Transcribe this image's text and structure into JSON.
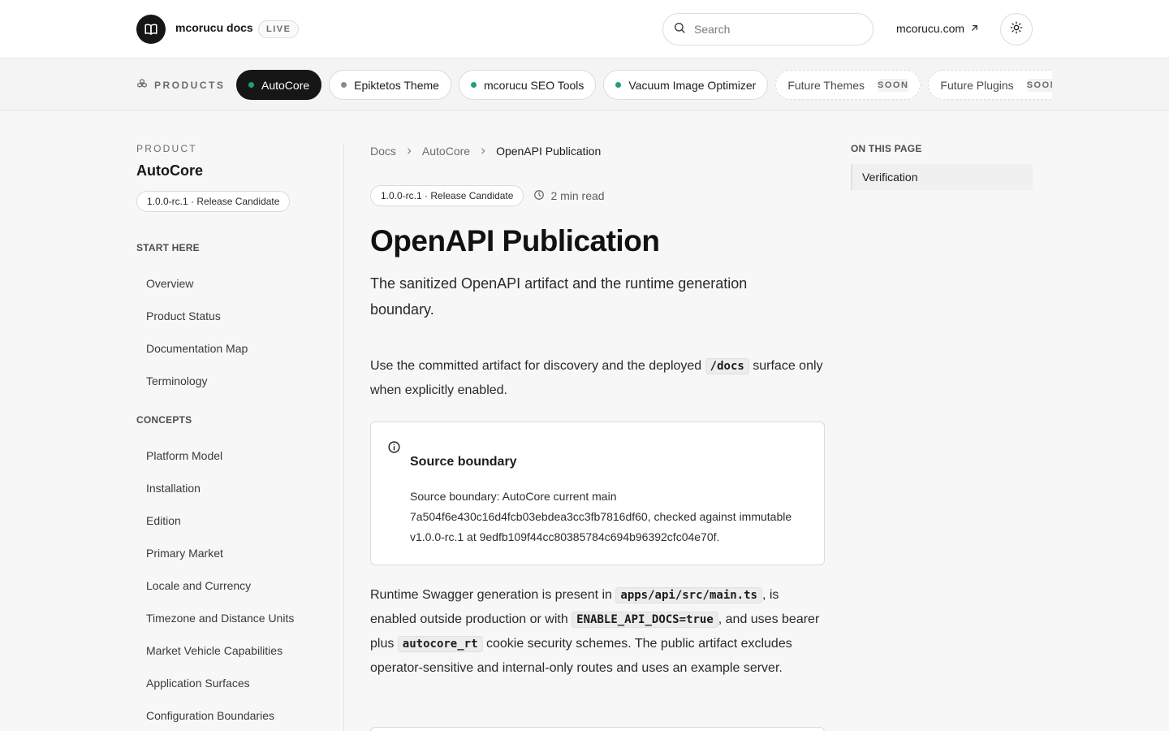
{
  "header": {
    "site_title": "mcorucu docs",
    "live_badge": "LIVE",
    "search_placeholder": "Search",
    "external_link": "mcorucu.com",
    "logo_icon": "book-icon",
    "theme_icon": "sun-icon"
  },
  "products": {
    "label": "PRODUCTS",
    "items": [
      {
        "label": "AutoCore",
        "dot_color": "#22a06b",
        "active": true
      },
      {
        "label": "Epiktetos Theme",
        "dot_color": "#8a8a8a",
        "active": false
      },
      {
        "label": "mcorucu SEO Tools",
        "dot_color": "#22a06b",
        "active": false
      },
      {
        "label": "Vacuum Image Optimizer",
        "dot_color": "#22a06b",
        "active": false
      }
    ],
    "future": [
      {
        "label": "Future Themes",
        "tag": "SOON"
      },
      {
        "label": "Future Plugins",
        "tag": "SOON"
      }
    ]
  },
  "sidebar": {
    "kicker": "PRODUCT",
    "product_name": "AutoCore",
    "version_badge": "1.0.0-rc.1 · Release Candidate",
    "sections": [
      {
        "title": "START HERE",
        "items": [
          "Overview",
          "Product Status",
          "Documentation Map",
          "Terminology"
        ]
      },
      {
        "title": "CONCEPTS",
        "items": [
          "Platform Model",
          "Installation",
          "Edition",
          "Primary Market",
          "Locale and Currency",
          "Timezone and Distance Units",
          "Market Vehicle Capabilities",
          "Application Surfaces",
          "Configuration Boundaries"
        ]
      }
    ]
  },
  "main": {
    "breadcrumb": [
      "Docs",
      "AutoCore",
      "OpenAPI Publication"
    ],
    "version_badge": "1.0.0-rc.1 · Release Candidate",
    "read_time": "2 min read",
    "title": "OpenAPI Publication",
    "lead": "The sanitized OpenAPI artifact and the runtime generation boundary.",
    "intro": {
      "before": "Use the committed artifact for discovery and the deployed ",
      "code": "/docs",
      "after": " surface only when explicitly enabled."
    },
    "callout": {
      "title": "Source boundary",
      "body": "Source boundary: AutoCore current main 7a504f6e430c16d4fcb03ebdea3cc3fb7816df60, checked against immutable v1.0.0-rc.1 at 9edfb109f44cc80385784c694b96392cfc04e70f."
    },
    "runtime": {
      "p1": "Runtime Swagger generation is present in ",
      "c1": "apps/api/src/main.ts",
      "p2": ", is enabled outside production or with ",
      "c2": "ENABLE_API_DOCS=true",
      "p3": ", and uses bearer plus ",
      "c3": "autocore_rt",
      "p4": " cookie security schemes. The public artifact excludes operator-sensitive and internal-only routes and uses an example server."
    }
  },
  "toc": {
    "heading": "ON THIS PAGE",
    "items": [
      "Verification"
    ]
  }
}
